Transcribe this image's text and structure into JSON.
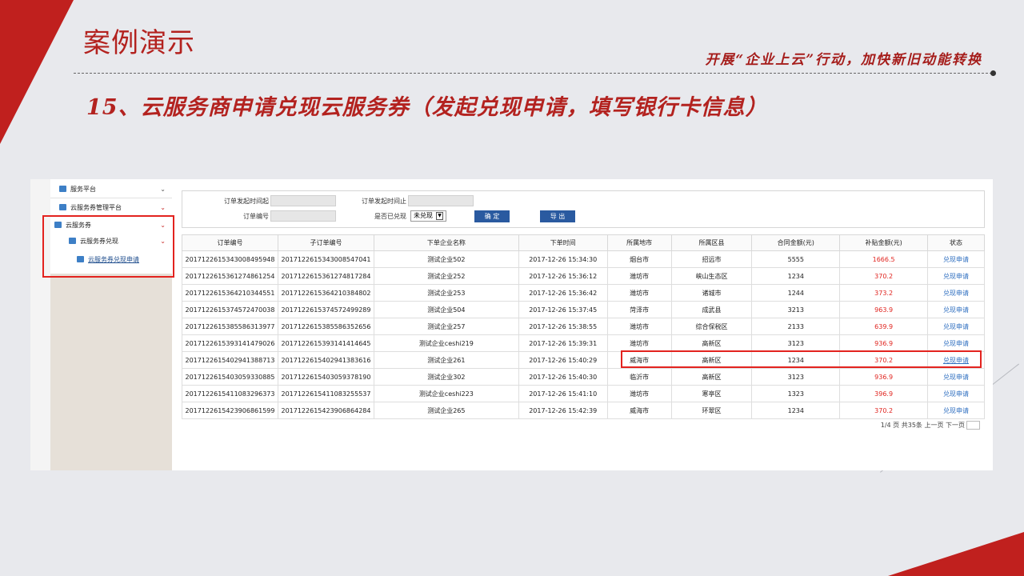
{
  "slide": {
    "title": "案例演示",
    "slogan": "开展“企业上云”行动，加快新旧动能转换",
    "subtitle": "15、云服务商申请兑现云服务券（发起兑现申请，填写银行卡信息）"
  },
  "sidebar": {
    "items": [
      {
        "label": "服务平台"
      },
      {
        "label": "云服务券管理平台"
      },
      {
        "label": "云服务券"
      },
      {
        "label": "云服务券兑现"
      },
      {
        "label": "云服务券兑现申请"
      }
    ]
  },
  "filter": {
    "start_label": "订单发起时间起",
    "end_label": "订单发起时间止",
    "order_no_label": "订单编号",
    "redeemed_label": "是否已兑现",
    "redeemed_value": "未兑现",
    "confirm_label": "确 定",
    "export_label": "导 出"
  },
  "table": {
    "headers": [
      "订单编号",
      "子订单编号",
      "下单企业名称",
      "下单时间",
      "所属地市",
      "所属区县",
      "合同金额(元)",
      "补贴金额(元)",
      "状态"
    ],
    "rows": [
      [
        "201712261534300849594​8",
        "2017122615343008547041",
        "测试企业502",
        "2017-12-26 15:34:30",
        "烟台市",
        "招远市",
        "5555",
        "1666.5",
        "兑现申请"
      ],
      [
        "2017122615361274861254",
        "2017122615361274817284",
        "测试企业252",
        "2017-12-26 15:36:12",
        "潍坊市",
        "峡山生态区",
        "1234",
        "370.2",
        "兑现申请"
      ],
      [
        "2017122615364210344551",
        "2017122615364210384802",
        "测试企业253",
        "2017-12-26 15:36:42",
        "潍坊市",
        "诸城市",
        "1244",
        "373.2",
        "兑现申请"
      ],
      [
        "2017122615374572470038",
        "2017122615374572499289",
        "测试企业504",
        "2017-12-26 15:37:45",
        "菏泽市",
        "成武县",
        "3213",
        "963.9",
        "兑现申请"
      ],
      [
        "2017122615385586313977",
        "2017122615385586352656",
        "测试企业257",
        "2017-12-26 15:38:55",
        "潍坊市",
        "综合保税区",
        "2133",
        "639.9",
        "兑现申请"
      ],
      [
        "2017122615393141479026",
        "2017122615393141414645",
        "测试企业ceshi219",
        "2017-12-26 15:39:31",
        "潍坊市",
        "高新区",
        "3123",
        "936.9",
        "兑现申请"
      ],
      [
        "2017122615402941388713",
        "2017122615402941383616",
        "测试企业261",
        "2017-12-26 15:40:29",
        "威海市",
        "高新区",
        "1234",
        "370.2",
        "兑现申请"
      ],
      [
        "2017122615403059330885",
        "2017122615403059378190",
        "测试企业302",
        "2017-12-26 15:40:30",
        "临沂市",
        "高新区",
        "3123",
        "936.9",
        "兑现申请"
      ],
      [
        "2017122615411083296373",
        "2017122615411083255537",
        "测试企业ceshi223",
        "2017-12-26 15:41:10",
        "潍坊市",
        "寒亭区",
        "1323",
        "396.9",
        "兑现申请"
      ],
      [
        "2017122615423906861599",
        "2017122615423906864284",
        "测试企业265",
        "2017-12-26 15:42:39",
        "威海市",
        "环翠区",
        "1234",
        "370.2",
        "兑现申请"
      ]
    ]
  },
  "pager": {
    "text": "1/4 页 共35条 上一页 下一页"
  },
  "colors": {
    "accent_red": "#c0201e",
    "link_blue": "#2f6fc0",
    "button_blue": "#2a5aa0"
  }
}
